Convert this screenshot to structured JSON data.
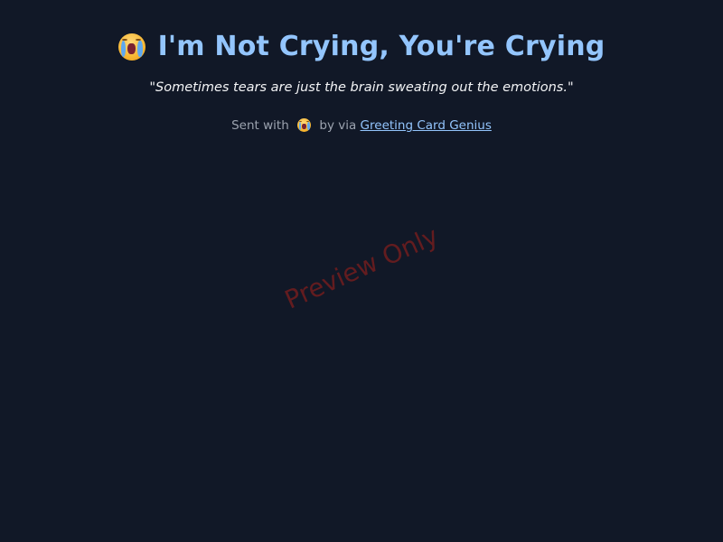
{
  "card": {
    "title_icon": "loudly-crying-face-emoji",
    "title": "I'm Not Crying, You're Crying",
    "quote": "\"Sometimes tears are just the brain sweating out the emotions.\"",
    "title_color": "#93c5fd",
    "background_color": "#111827"
  },
  "footer": {
    "sent_with": "Sent with",
    "sent_icon": "loudly-crying-face-emoji",
    "by_via": "by via",
    "link_text": "Greeting Card Genius",
    "link_color": "#93c5fd"
  },
  "watermark": {
    "text": "Preview Only",
    "color": "#7f1d1d"
  }
}
